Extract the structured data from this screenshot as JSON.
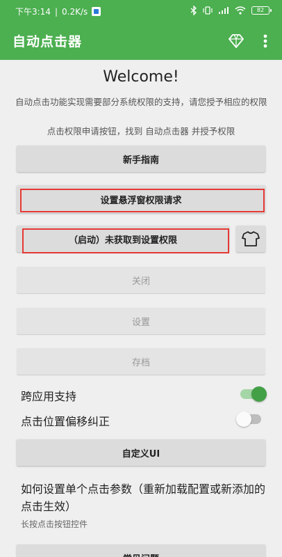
{
  "status_bar": {
    "time": "下午3:14",
    "separator": "|",
    "speed": "0.2K/s",
    "battery": "82"
  },
  "toolbar": {
    "title": "自动点击器",
    "icons": [
      "diamond-icon",
      "more-vert-icon"
    ]
  },
  "main": {
    "welcome": "Welcome!",
    "description": "自动点击功能实现需要部分系统权限的支持，请您授予相应的权限",
    "instruction": "点击权限申请按钮，找到 自动点击器 并授予权限",
    "buttons": {
      "guide": "新手指南",
      "overlay_permission": "设置悬浮窗权限请求",
      "start": "（启动）未获取到设置权限",
      "close": "关闭",
      "settings": "设置",
      "archive": "存档",
      "custom_ui": "自定义UI",
      "faq": "常见问题"
    },
    "switches": {
      "cross_app": {
        "label": "跨应用支持",
        "on": true
      },
      "offset_correction": {
        "label": "点击位置偏移纠正",
        "on": false
      }
    },
    "howto": {
      "title": "如何设置单个点击参数（重新加载配置或新添加的点击生效）",
      "subtitle": "长按点击按钮控件"
    }
  },
  "colors": {
    "primary": "#4caf50",
    "highlight": "#e53935"
  }
}
